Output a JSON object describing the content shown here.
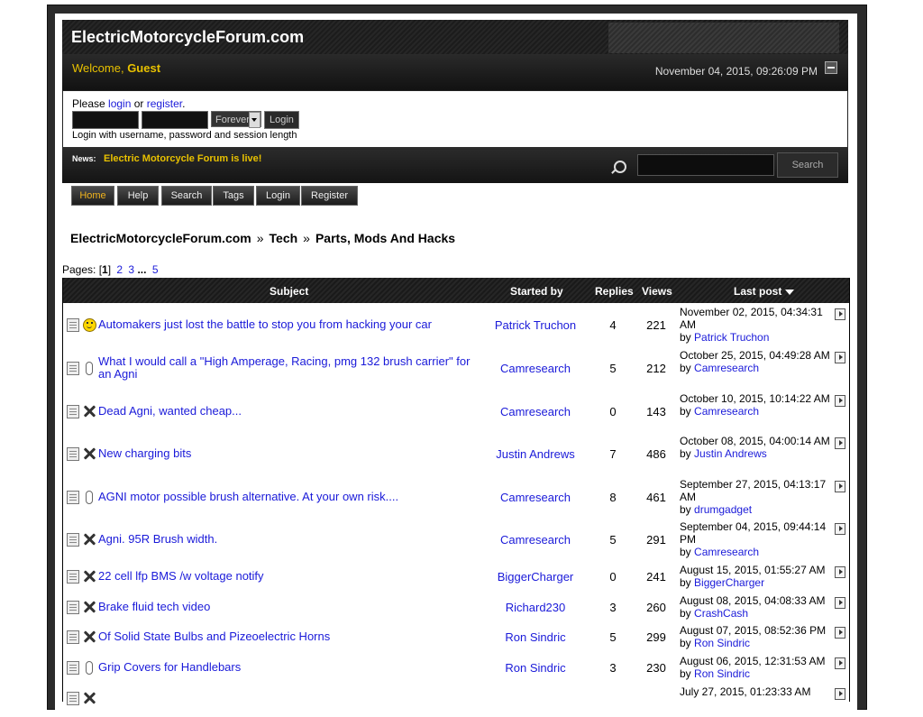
{
  "site": {
    "title": "ElectricMotorcycleForum.com",
    "welcome_prefix": "Welcome,",
    "welcome_user": "Guest",
    "datetime": "November 04, 2015, 09:26:09 PM"
  },
  "login": {
    "please": "Please",
    "login_link": "login",
    "or": "or",
    "register_link": "register",
    "period": ".",
    "session_option": "Forever",
    "login_button": "Login",
    "hint": "Login with username, password and session length"
  },
  "news": {
    "label": "News:",
    "text": "Electric Motorcycle Forum is live!",
    "search_button": "Search"
  },
  "tabs": [
    "Home",
    "Help",
    "Search",
    "Tags",
    "Login",
    "Register"
  ],
  "breadcrumb": [
    "ElectricMotorcycleForum.com",
    "Tech",
    "Parts, Mods And Hacks"
  ],
  "breadcrumb_sep": "»",
  "pagination": {
    "label": "Pages:",
    "current": "1",
    "pages": [
      "2",
      "3"
    ],
    "ellipsis": "...",
    "last": "5"
  },
  "table": {
    "headers": {
      "subject": "Subject",
      "started_by": "Started by",
      "replies": "Replies",
      "views": "Views",
      "last_post": "Last post"
    },
    "rows": [
      {
        "icon": "smiley-icon",
        "subject": "Automakers just lost the battle to stop you from hacking your car",
        "starter": "Patrick Truchon",
        "replies": "4",
        "views": "221",
        "lp_date": "November 02, 2015, 04:34:31 AM",
        "lp_by": "Patrick Truchon"
      },
      {
        "icon": "paperclip-icon",
        "subject": "What I would call a \"High Amperage, Racing, pmg 132 brush carrier\" for an Agni",
        "starter": "Camresearch",
        "replies": "5",
        "views": "212",
        "lp_date": "October 25, 2015, 04:49:28 AM",
        "lp_by": "Camresearch"
      },
      {
        "icon": "x-icon",
        "subject": "Dead Agni, wanted cheap...",
        "starter": "Camresearch",
        "replies": "0",
        "views": "143",
        "lp_date": "October 10, 2015, 10:14:22 AM",
        "lp_by": "Camresearch"
      },
      {
        "icon": "x-icon",
        "subject": "New charging bits",
        "starter": "Justin Andrews",
        "replies": "7",
        "views": "486",
        "lp_date": "October 08, 2015, 04:00:14 AM",
        "lp_by": "Justin Andrews"
      },
      {
        "icon": "paperclip-icon",
        "subject": "AGNI motor possible brush alternative. At your own risk....",
        "starter": "Camresearch",
        "replies": "8",
        "views": "461",
        "lp_date": "September 27, 2015, 04:13:17 AM",
        "lp_by": "drumgadget"
      },
      {
        "icon": "x-icon",
        "subject": "Agni. 95R Brush width.",
        "starter": "Camresearch",
        "replies": "5",
        "views": "291",
        "lp_date": "September 04, 2015, 09:44:14 PM",
        "lp_by": "Camresearch"
      },
      {
        "icon": "x-icon",
        "subject": "22 cell lfp BMS /w voltage notify",
        "starter": "BiggerCharger",
        "replies": "0",
        "views": "241",
        "lp_date": "August 15, 2015, 01:55:27 AM",
        "lp_by": "BiggerCharger"
      },
      {
        "icon": "x-icon",
        "subject": "Brake fluid tech video",
        "starter": "Richard230",
        "replies": "3",
        "views": "260",
        "lp_date": "August 08, 2015, 04:08:33 AM",
        "lp_by": "CrashCash"
      },
      {
        "icon": "x-icon",
        "subject": "Of Solid State Bulbs and Pizeoelectric Horns",
        "starter": "Ron Sindric",
        "replies": "5",
        "views": "299",
        "lp_date": "August 07, 2015, 08:52:36 PM",
        "lp_by": "Ron Sindric"
      },
      {
        "icon": "paperclip-icon",
        "subject": "Grip Covers for Handlebars",
        "starter": "Ron Sindric",
        "replies": "3",
        "views": "230",
        "lp_date": "August 06, 2015, 12:31:53 AM",
        "lp_by": "Ron Sindric"
      },
      {
        "icon": "x-icon",
        "subject": "",
        "starter": "",
        "replies": "",
        "views": "",
        "lp_date": "July 27, 2015, 01:23:33 AM",
        "lp_by": ""
      }
    ],
    "by_prefix": "by"
  }
}
